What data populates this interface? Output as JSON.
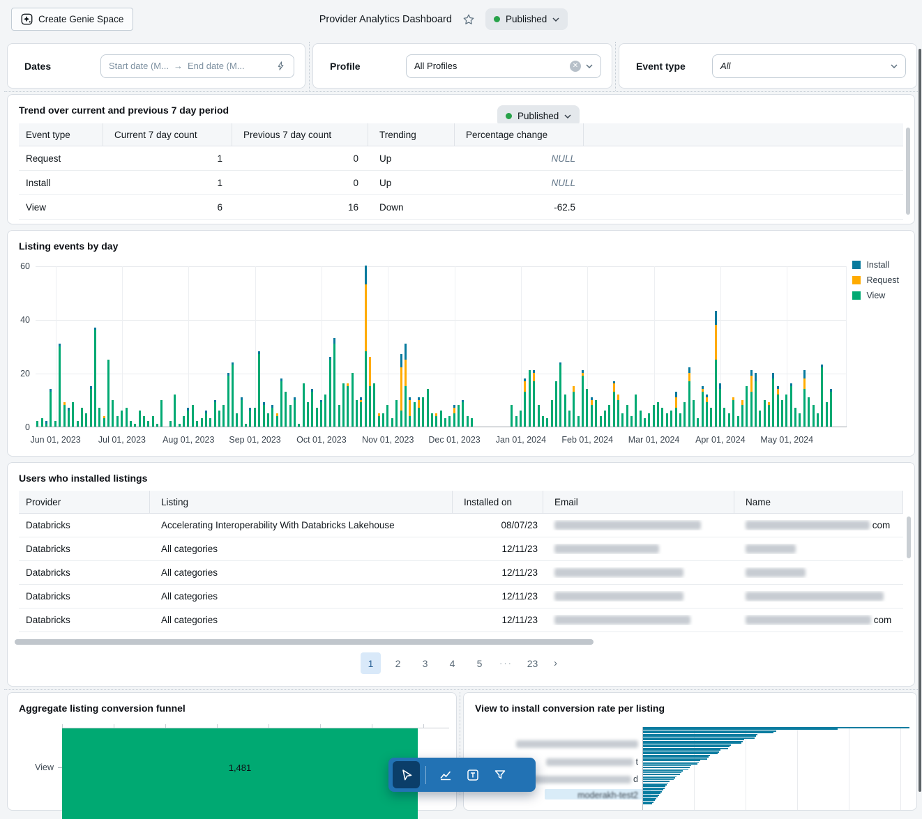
{
  "topbar": {
    "create_genie_label": "Create Genie Space",
    "title": "Provider Analytics Dashboard",
    "status_label": "Published"
  },
  "filters": {
    "dates": {
      "label": "Dates",
      "start_placeholder": "Start date (M...",
      "end_placeholder": "End date (M..."
    },
    "profile": {
      "label": "Profile",
      "value": "All Profiles"
    },
    "event_type": {
      "label": "Event type",
      "value": "All"
    }
  },
  "trend": {
    "title": "Trend over current and previous 7 day period",
    "status_label": "Published",
    "columns": [
      "Event type",
      "Current 7 day count",
      "Previous 7 day count",
      "Trending",
      "Percentage change"
    ],
    "rows": [
      [
        "Request",
        "1",
        "0",
        "Up",
        "NULL"
      ],
      [
        "Install",
        "1",
        "0",
        "Up",
        "NULL"
      ],
      [
        "View",
        "6",
        "16",
        "Down",
        "-62.5"
      ]
    ]
  },
  "chart_data": [
    {
      "name": "listing-events-by-day",
      "type": "bar",
      "stacked": true,
      "title": "Listing events by day",
      "legend": [
        "Install",
        "Request",
        "View"
      ],
      "colors": {
        "Install": "#077A9D",
        "Request": "#FFAB00",
        "View": "#00A972"
      },
      "ylim": [
        0,
        60
      ],
      "yticks": [
        0,
        20,
        40,
        60
      ],
      "x_tick_labels": [
        "Jun 01, 2023",
        "Jul 01, 2023",
        "Aug 01, 2023",
        "Sep 01, 2023",
        "Oct 01, 2023",
        "Nov 01, 2023",
        "Dec 01, 2023",
        "Jan 01, 2024",
        "Feb 01, 2024",
        "Mar 01, 2024",
        "Apr 01, 2024",
        "May 01, 2024"
      ],
      "tick_start_index": 3,
      "tick_step": 15,
      "series_order": [
        "view",
        "request",
        "install"
      ],
      "days": [
        [
          2,
          0,
          0
        ],
        [
          3,
          0,
          0
        ],
        [
          1,
          0,
          1
        ],
        [
          13,
          0,
          1
        ],
        [
          2,
          0,
          0
        ],
        [
          30,
          0,
          1
        ],
        [
          8,
          1,
          0
        ],
        [
          6,
          0,
          1
        ],
        [
          9,
          0,
          0
        ],
        [
          2,
          0,
          0
        ],
        [
          7,
          0,
          0
        ],
        [
          5,
          0,
          0
        ],
        [
          14,
          0,
          1
        ],
        [
          36,
          0,
          1
        ],
        [
          7,
          0,
          0
        ],
        [
          3,
          1,
          0
        ],
        [
          25,
          0,
          0
        ],
        [
          10,
          0,
          0
        ],
        [
          4,
          0,
          0
        ],
        [
          6,
          0,
          0
        ],
        [
          7,
          0,
          0
        ],
        [
          2,
          0,
          0
        ],
        [
          1,
          0,
          0
        ],
        [
          6,
          0,
          0
        ],
        [
          4,
          0,
          0
        ],
        [
          2,
          0,
          0
        ],
        [
          4,
          0,
          0
        ],
        [
          1,
          0,
          0
        ],
        [
          10,
          0,
          0
        ],
        [
          0,
          0,
          0
        ],
        [
          2,
          0,
          0
        ],
        [
          12,
          0,
          0
        ],
        [
          1,
          0,
          0
        ],
        [
          4,
          0,
          0
        ],
        [
          6,
          0,
          1
        ],
        [
          8,
          0,
          0
        ],
        [
          2,
          0,
          0
        ],
        [
          3,
          0,
          0
        ],
        [
          5,
          0,
          1
        ],
        [
          3,
          0,
          0
        ],
        [
          9,
          0,
          1
        ],
        [
          6,
          0,
          0
        ],
        [
          8,
          0,
          0
        ],
        [
          19,
          0,
          1
        ],
        [
          23,
          0,
          1
        ],
        [
          5,
          0,
          0
        ],
        [
          10,
          0,
          1
        ],
        [
          1,
          0,
          0
        ],
        [
          6,
          0,
          1
        ],
        [
          7,
          0,
          0
        ],
        [
          27,
          0,
          1
        ],
        [
          8,
          0,
          1
        ],
        [
          5,
          0,
          0
        ],
        [
          7,
          0,
          1
        ],
        [
          4,
          1,
          0
        ],
        [
          17,
          0,
          1
        ],
        [
          13,
          0,
          0
        ],
        [
          8,
          0,
          0
        ],
        [
          10,
          0,
          1
        ],
        [
          1,
          0,
          0
        ],
        [
          16,
          0,
          0
        ],
        [
          9,
          0,
          0
        ],
        [
          13,
          0,
          1
        ],
        [
          7,
          0,
          0
        ],
        [
          9,
          0,
          1
        ],
        [
          12,
          0,
          0
        ],
        [
          25,
          0,
          1
        ],
        [
          31,
          0,
          2
        ],
        [
          8,
          0,
          0
        ],
        [
          16,
          0,
          0
        ],
        [
          15,
          1,
          0
        ],
        [
          20,
          0,
          0
        ],
        [
          10,
          0,
          0
        ],
        [
          9,
          1,
          1
        ],
        [
          28,
          25,
          7
        ],
        [
          15,
          11,
          0
        ],
        [
          16,
          0,
          0
        ],
        [
          4,
          1,
          0
        ],
        [
          5,
          0,
          0
        ],
        [
          8,
          0,
          0
        ],
        [
          3,
          0,
          0
        ],
        [
          10,
          0,
          0
        ],
        [
          6,
          16,
          5
        ],
        [
          15,
          10,
          6
        ],
        [
          4,
          6,
          1
        ],
        [
          9,
          0,
          0
        ],
        [
          7,
          3,
          1
        ],
        [
          11,
          0,
          0
        ],
        [
          14,
          0,
          0
        ],
        [
          5,
          0,
          0
        ],
        [
          4,
          1,
          0
        ],
        [
          6,
          0,
          0
        ],
        [
          3,
          0,
          0
        ],
        [
          4,
          0,
          0
        ],
        [
          5,
          2,
          1
        ],
        [
          8,
          0,
          0
        ],
        [
          9,
          0,
          1
        ],
        [
          4,
          0,
          0
        ],
        [
          3,
          0,
          0
        ],
        [
          0,
          0,
          0
        ],
        [
          0,
          0,
          0
        ],
        [
          0,
          0,
          0
        ],
        [
          0,
          0,
          0
        ],
        [
          0,
          0,
          0
        ],
        [
          0,
          0,
          0
        ],
        [
          0,
          0,
          0
        ],
        [
          0,
          0,
          0
        ],
        [
          8,
          0,
          0
        ],
        [
          4,
          0,
          0
        ],
        [
          6,
          0,
          0
        ],
        [
          13,
          4,
          1
        ],
        [
          21,
          0,
          0
        ],
        [
          17,
          3,
          1
        ],
        [
          8,
          0,
          0
        ],
        [
          4,
          0,
          0
        ],
        [
          3,
          0,
          0
        ],
        [
          10,
          0,
          0
        ],
        [
          17,
          0,
          0
        ],
        [
          23,
          0,
          1
        ],
        [
          12,
          0,
          0
        ],
        [
          6,
          0,
          0
        ],
        [
          13,
          2,
          0
        ],
        [
          4,
          0,
          0
        ],
        [
          19,
          1,
          1
        ],
        [
          14,
          0,
          0
        ],
        [
          8,
          2,
          1
        ],
        [
          10,
          0,
          0
        ],
        [
          4,
          0,
          0
        ],
        [
          6,
          0,
          0
        ],
        [
          8,
          0,
          0
        ],
        [
          13,
          3,
          1
        ],
        [
          10,
          2,
          0
        ],
        [
          5,
          0,
          0
        ],
        [
          8,
          0,
          0
        ],
        [
          4,
          0,
          0
        ],
        [
          12,
          0,
          0
        ],
        [
          6,
          0,
          0
        ],
        [
          3,
          0,
          0
        ],
        [
          5,
          0,
          0
        ],
        [
          8,
          0,
          0
        ],
        [
          9,
          0,
          0
        ],
        [
          7,
          0,
          0
        ],
        [
          5,
          0,
          0
        ],
        [
          6,
          0,
          0
        ],
        [
          7,
          4,
          2
        ],
        [
          5,
          0,
          0
        ],
        [
          9,
          0,
          0
        ],
        [
          17,
          3,
          2
        ],
        [
          10,
          0,
          0
        ],
        [
          3,
          0,
          0
        ],
        [
          13,
          1,
          1
        ],
        [
          9,
          2,
          1
        ],
        [
          7,
          0,
          0
        ],
        [
          25,
          13,
          5
        ],
        [
          14,
          0,
          2
        ],
        [
          7,
          0,
          0
        ],
        [
          5,
          0,
          0
        ],
        [
          10,
          1,
          0
        ],
        [
          4,
          0,
          0
        ],
        [
          8,
          2,
          0
        ],
        [
          15,
          0,
          0
        ],
        [
          13,
          6,
          2
        ],
        [
          17,
          0,
          3
        ],
        [
          6,
          0,
          0
        ],
        [
          10,
          0,
          0
        ],
        [
          8,
          1,
          0
        ],
        [
          18,
          0,
          2
        ],
        [
          12,
          2,
          1
        ],
        [
          10,
          0,
          0
        ],
        [
          12,
          0,
          0
        ],
        [
          15,
          0,
          1
        ],
        [
          7,
          0,
          0
        ],
        [
          5,
          0,
          0
        ],
        [
          14,
          4,
          3
        ],
        [
          11,
          0,
          0
        ],
        [
          8,
          0,
          0
        ],
        [
          5,
          0,
          0
        ],
        [
          22,
          0,
          1
        ],
        [
          9,
          0,
          0
        ],
        [
          13,
          0,
          1
        ],
        [
          0,
          0,
          0
        ],
        [
          0,
          0,
          0
        ],
        [
          0,
          0,
          0
        ]
      ]
    },
    {
      "name": "aggregate-listing-conversion-funnel",
      "type": "funnel",
      "title": "Aggregate listing conversion funnel",
      "categories": [
        "View"
      ],
      "values": [
        1481
      ],
      "value_labels": [
        "1,481"
      ],
      "color": "#00A972"
    },
    {
      "name": "view-to-install-conversion-rate-per-listing",
      "type": "bar-horizontal",
      "title": "View to install conversion rate per listing",
      "color": "#0A7CA0",
      "values": [
        100,
        73,
        50,
        49,
        43,
        42.5,
        42,
        38,
        37.5,
        37,
        33,
        32.5,
        32,
        29,
        28.5,
        28,
        25,
        24.5,
        24,
        21.5,
        21,
        20.5,
        18,
        17.5,
        17,
        15,
        14.5,
        14,
        12.5,
        12,
        11.5,
        10,
        9.5,
        9,
        8.5,
        8,
        7.5,
        7,
        6.5,
        6,
        5.5,
        5,
        4.5,
        4,
        3.5
      ],
      "redacted_labels": [
        {
          "blur_w": 175,
          "tail": ""
        },
        {
          "blur_w": 125,
          "tail": "t"
        },
        {
          "blur_w": 165,
          "tail": "d"
        },
        {
          "blur_w": 0,
          "tail": "moderakh-test2"
        }
      ]
    }
  ],
  "users": {
    "title": "Users who installed listings",
    "columns": [
      "Provider",
      "Listing",
      "Installed on",
      "Email",
      "Name"
    ],
    "rows": [
      {
        "provider": "Databricks",
        "listing": "Accelerating Interoperability With Databricks Lakehouse",
        "installed_on": "08/07/23",
        "email_w": 210,
        "name_w": 178,
        "name_suffix": "com"
      },
      {
        "provider": "Databricks",
        "listing": "All categories",
        "installed_on": "12/11/23",
        "email_w": 150,
        "name_w": 72,
        "name_suffix": ""
      },
      {
        "provider": "Databricks",
        "listing": "All categories",
        "installed_on": "12/11/23",
        "email_w": 185,
        "name_w": 86,
        "name_suffix": ""
      },
      {
        "provider": "Databricks",
        "listing": "All categories",
        "installed_on": "12/11/23",
        "email_w": 185,
        "name_w": 198,
        "name_suffix": ""
      },
      {
        "provider": "Databricks",
        "listing": "All categories",
        "installed_on": "12/11/23",
        "email_w": 195,
        "name_w": 180,
        "name_suffix": "com"
      }
    ],
    "pagination": {
      "pages": [
        "1",
        "2",
        "3",
        "4",
        "5",
        "···",
        "23"
      ],
      "current": "1",
      "next": "›"
    }
  }
}
